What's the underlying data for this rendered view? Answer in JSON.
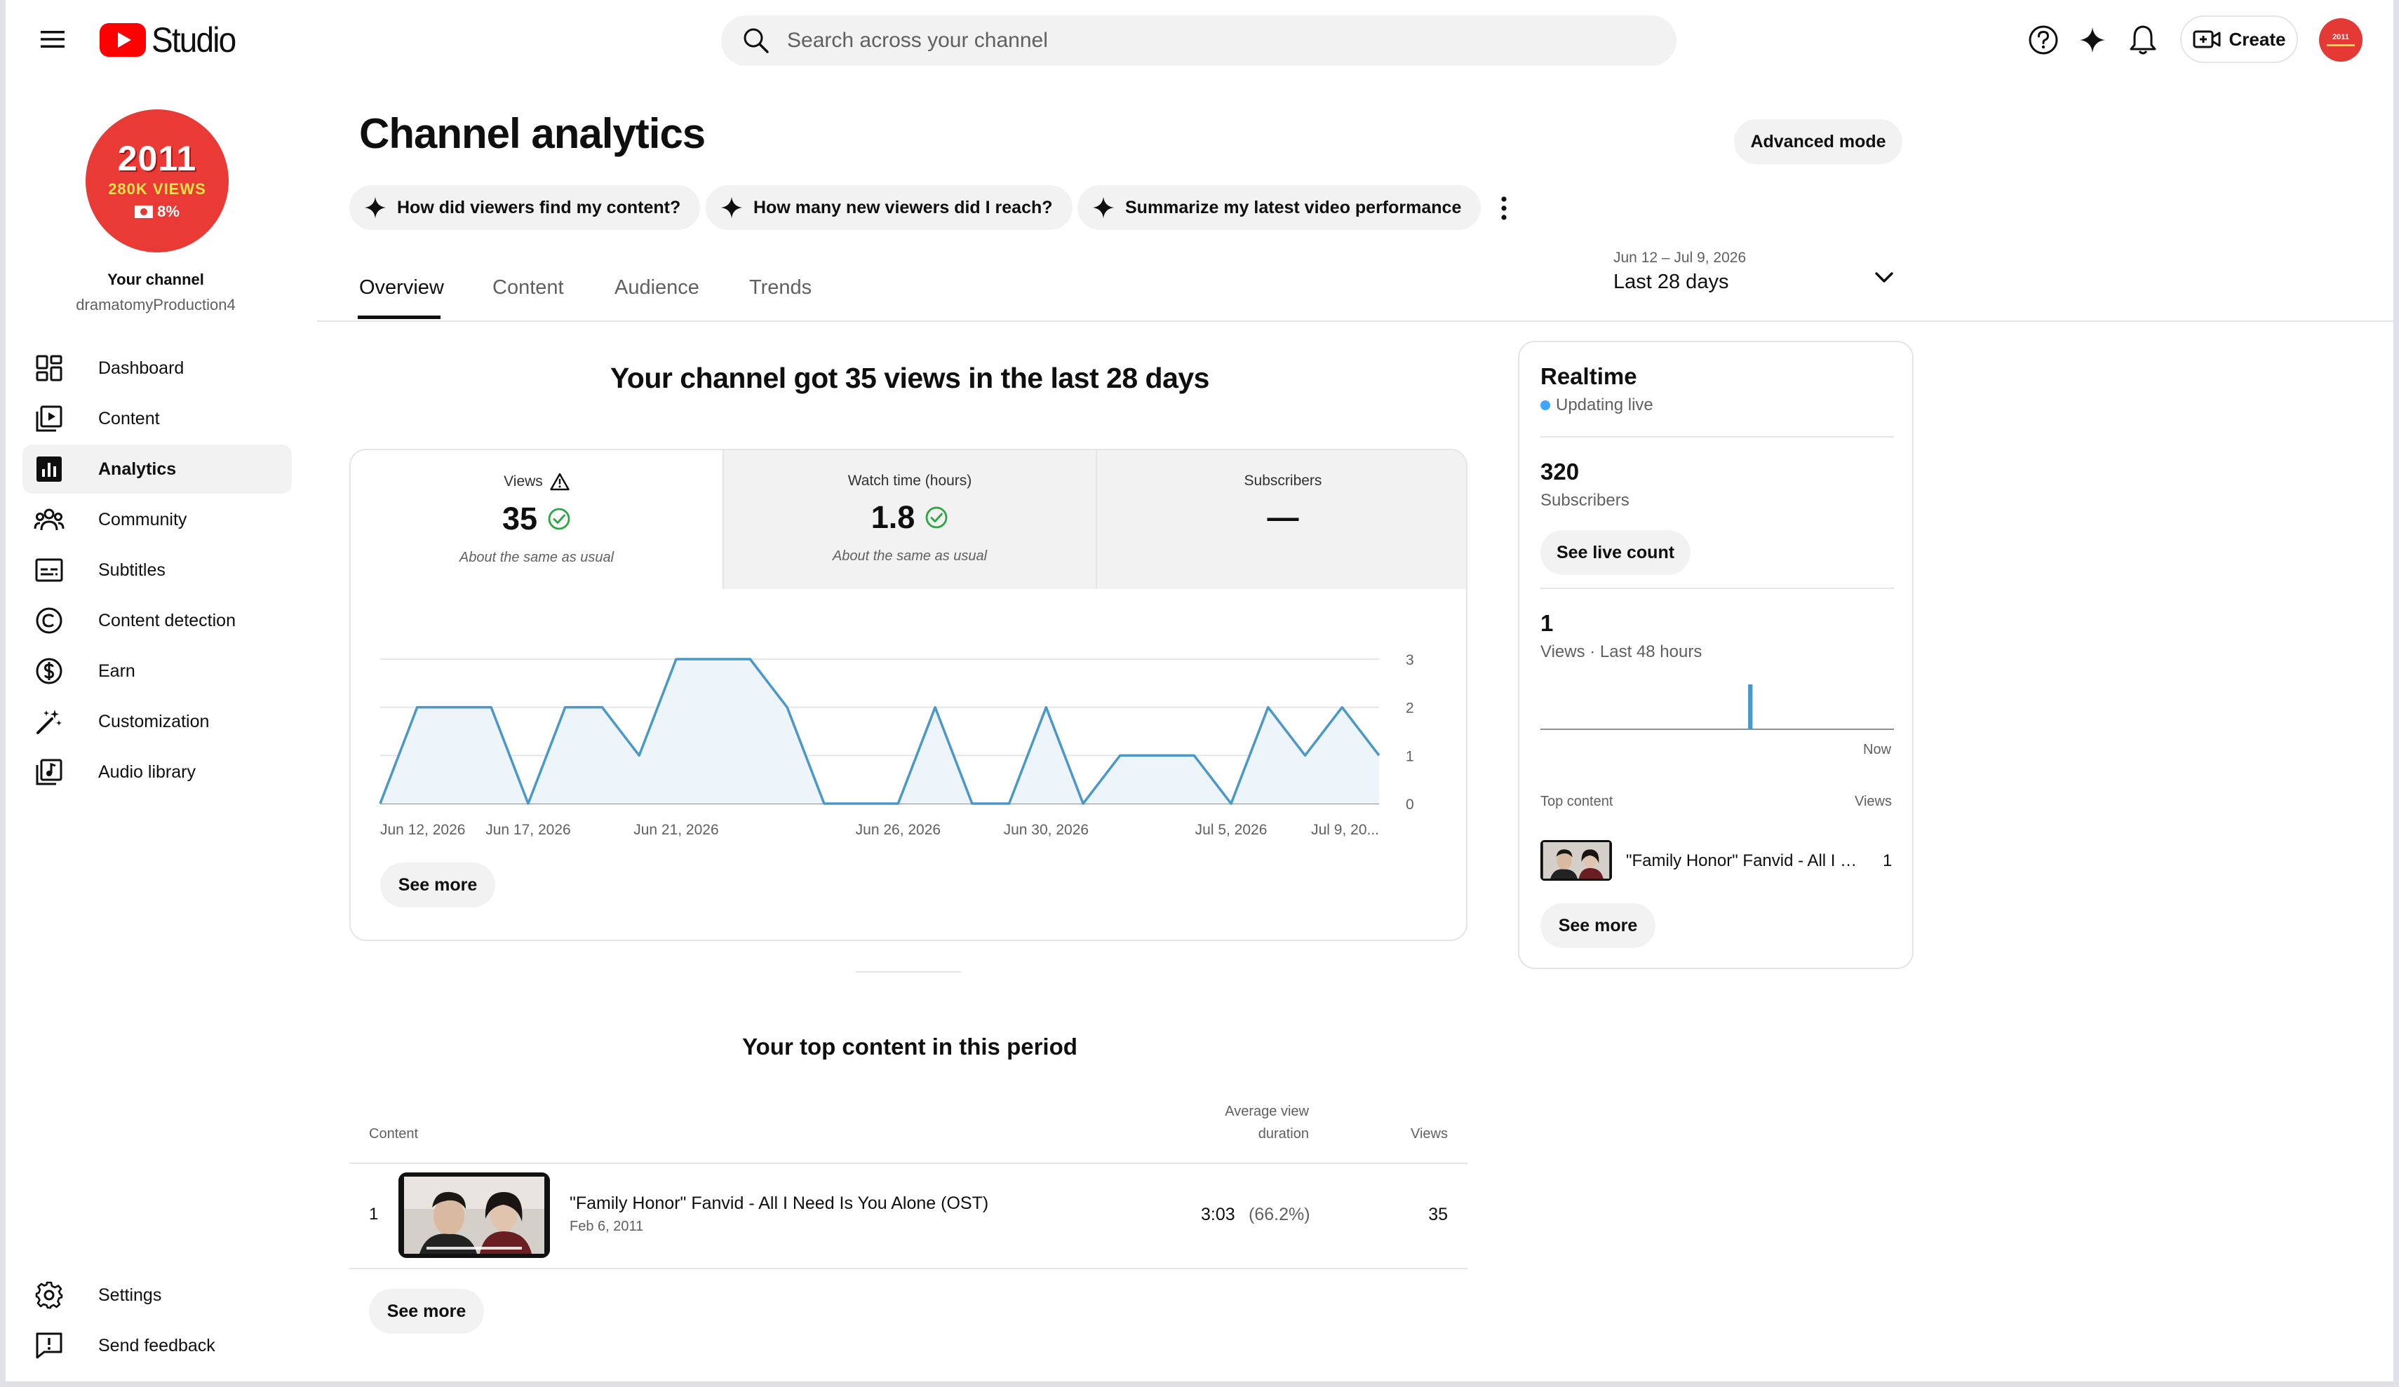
{
  "header": {
    "logo_text": "Studio",
    "search_placeholder": "Search across your channel",
    "create_label": "Create",
    "avatar_small_text": "2011"
  },
  "sidebar": {
    "avatar": {
      "year": "2011",
      "views_text": "280K VIEWS",
      "pct_text": "8%"
    },
    "channel_label": "Your channel",
    "channel_handle": "dramatomyProduction4",
    "items": [
      {
        "label": "Dashboard",
        "icon": "dashboard-icon"
      },
      {
        "label": "Content",
        "icon": "content-icon"
      },
      {
        "label": "Analytics",
        "icon": "analytics-icon"
      },
      {
        "label": "Community",
        "icon": "community-icon"
      },
      {
        "label": "Subtitles",
        "icon": "subtitles-icon"
      },
      {
        "label": "Content detection",
        "icon": "copyright-icon"
      },
      {
        "label": "Earn",
        "icon": "earn-icon"
      },
      {
        "label": "Customization",
        "icon": "customization-icon"
      },
      {
        "label": "Audio library",
        "icon": "audio-library-icon"
      }
    ],
    "active_item": "Analytics",
    "bottom_items": [
      {
        "label": "Settings",
        "icon": "gear-icon"
      },
      {
        "label": "Send feedback",
        "icon": "feedback-icon"
      }
    ]
  },
  "main": {
    "title": "Channel analytics",
    "advanced_mode_label": "Advanced mode",
    "chips": [
      "How did viewers find my content?",
      "How many new viewers did I reach?",
      "Summarize my latest video performance"
    ],
    "tabs": [
      "Overview",
      "Content",
      "Audience",
      "Trends"
    ],
    "active_tab": "Overview",
    "date_range": "Jun 12 – Jul 9, 2026",
    "date_label": "Last 28 days",
    "headline": "Your channel got 35 views in the last 28 days",
    "metrics": [
      {
        "label": "Views",
        "value": "35",
        "sub": "About the same as usual"
      },
      {
        "label": "Watch time (hours)",
        "value": "1.8",
        "sub": "About the same as usual"
      },
      {
        "label": "Subscribers",
        "value": "—",
        "sub": ""
      }
    ],
    "chart_see_more": "See more",
    "top_content": {
      "title": "Your top content in this period",
      "col_content": "Content",
      "col_avd_line1": "Average view",
      "col_avd_line2": "duration",
      "col_views": "Views",
      "rows": [
        {
          "rank": "1",
          "title": "\"Family Honor\" Fanvid - All I Need Is You Alone (OST)",
          "date": "Feb 6, 2011",
          "avd": "3:03",
          "avd_pct": "(66.2%)",
          "views": "35"
        }
      ],
      "see_more": "See more"
    }
  },
  "realtime": {
    "title": "Realtime",
    "live_label": "Updating live",
    "subscribers": "320",
    "subscribers_label": "Subscribers",
    "live_count_label": "See live count",
    "views": "1",
    "views_label": "Views · Last 48 hours",
    "now_label": "Now",
    "top_content_label": "Top content",
    "views_col_label": "Views",
    "top_video_title": "\"Family Honor\" Fanvid - All I Need Is You Alone (OST)",
    "top_video_views": "1",
    "see_more": "See more",
    "spark_values": [
      0,
      0,
      0,
      0,
      0,
      0,
      0,
      0,
      0,
      0,
      0,
      0,
      0,
      0,
      0,
      0,
      0,
      0,
      0,
      0,
      0,
      0,
      0,
      0,
      0,
      0,
      0,
      0,
      1,
      0,
      0,
      0,
      0,
      0,
      0,
      0,
      0,
      0,
      0,
      0,
      0,
      0,
      0,
      0,
      0,
      0,
      0,
      0
    ]
  },
  "colors": {
    "accent_red": "#ff0000",
    "line_blue": "#4a98c9",
    "fill_blue": "#eef5fa",
    "check_green": "#2ba640"
  },
  "chart_data": {
    "type": "area",
    "title": "",
    "xlabel": "",
    "ylabel": "",
    "ylim": [
      0,
      3
    ],
    "yticks": [
      "0",
      "1",
      "2",
      "3"
    ],
    "x_tick_labels": [
      {
        "index": 0,
        "label": "Jun 12, 2026"
      },
      {
        "index": 4,
        "label": "Jun 17, 2026"
      },
      {
        "index": 8,
        "label": "Jun 21, 2026"
      },
      {
        "index": 14,
        "label": "Jun 26, 2026"
      },
      {
        "index": 18,
        "label": "Jun 30, 2026"
      },
      {
        "index": 23,
        "label": "Jul 5, 2026"
      },
      {
        "index": 27,
        "label": "Jul 9, 20..."
      }
    ],
    "series": [
      {
        "values": [
          0,
          2,
          2,
          2,
          0,
          2,
          2,
          1,
          3,
          3,
          3,
          2,
          0,
          0,
          0,
          2,
          0,
          0,
          2,
          0,
          1,
          1,
          1,
          0,
          2,
          1,
          2,
          1
        ]
      }
    ]
  }
}
